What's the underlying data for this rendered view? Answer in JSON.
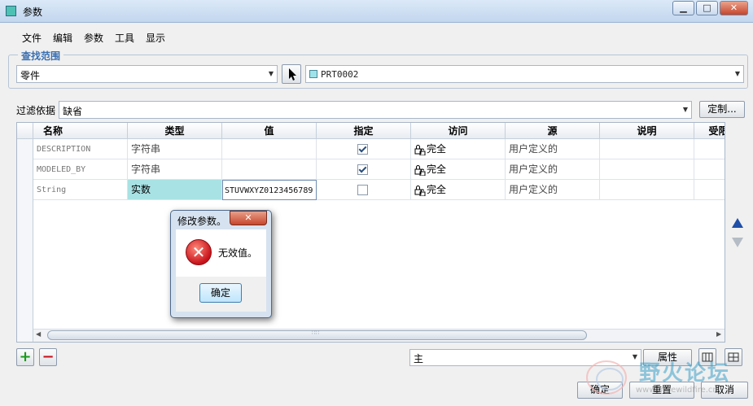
{
  "window": {
    "title": "参数",
    "min_glyph": "▁",
    "max_glyph": "□",
    "close_glyph": "✕"
  },
  "menu": [
    "文件",
    "编辑",
    "参数",
    "工具",
    "显示"
  ],
  "search_scope": {
    "legend": "查找范围",
    "type_value": "零件",
    "model_value": "PRT0002"
  },
  "filter": {
    "label": "过滤依据",
    "value": "缺省",
    "custom_button": "定制..."
  },
  "table": {
    "columns": [
      "名称",
      "类型",
      "值",
      "指定",
      "访问",
      "源",
      "说明",
      "受限"
    ],
    "rows": [
      {
        "name": "DESCRIPTION",
        "type": "字符串",
        "value": "",
        "designated": true,
        "access": "完全",
        "source": "用户定义的",
        "description": ""
      },
      {
        "name": "MODELED_BY",
        "type": "字符串",
        "value": "",
        "designated": true,
        "access": "完全",
        "source": "用户定义的",
        "description": ""
      },
      {
        "name": "String",
        "type": "实数",
        "value": "STUVWXYZ0123456789",
        "designated": false,
        "access": "完全",
        "source": "用户定义的",
        "description": ""
      }
    ],
    "scroll_grip": "∷∷"
  },
  "bottom": {
    "add_glyph": "+",
    "remove_glyph": "−",
    "view_value": "主",
    "properties_button": "属性",
    "ok_button": "确定",
    "reset_button": "重置",
    "cancel_button": "取消"
  },
  "dialog": {
    "title": "修改参数。",
    "message": "无效值。",
    "ok_button": "确定",
    "close_glyph": "✕",
    "error_glyph": "✕"
  },
  "watermark": {
    "text": "野火论坛",
    "url_text": "www.proewildfire.cn"
  },
  "colors": {
    "accent": "#3a6fb0",
    "selected_cell": "#a8e2e4",
    "error": "#c8121b"
  }
}
